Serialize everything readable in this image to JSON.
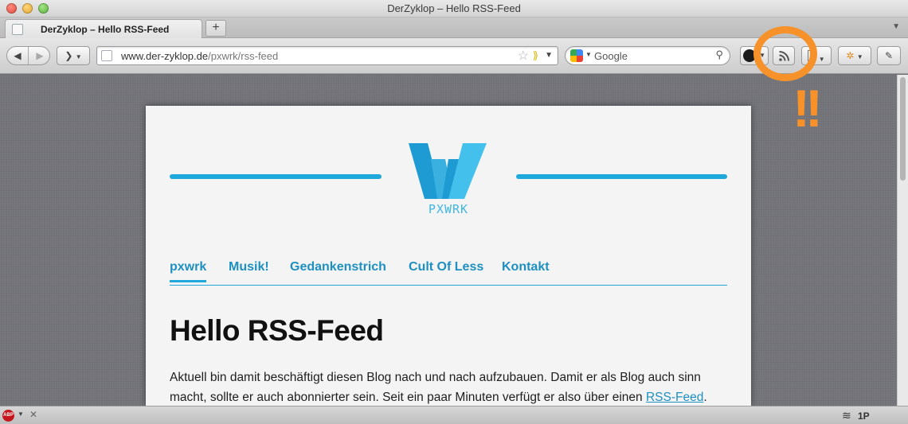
{
  "window": {
    "title": "DerZyklop – Hello RSS-Feed"
  },
  "tabs": [
    {
      "label": "DerZyklop – Hello RSS-Feed"
    }
  ],
  "toolbar": {
    "back_glyph": "◀",
    "forward_glyph": "▶",
    "reader_glyph": "❯",
    "url_domain": "www.der-zyklop.de",
    "url_path": "/pxwrk/rss-feed",
    "search_placeholder": "Google"
  },
  "annotation": {
    "marks": "!!",
    "color": "#f7922a"
  },
  "site": {
    "logo_text": "PXWRK",
    "nav": [
      {
        "label": "pxwrk",
        "active": true
      },
      {
        "label": "Musik!"
      },
      {
        "label": "Gedankenstrich"
      },
      {
        "label": "Cult Of Less"
      },
      {
        "label": "Kontakt"
      }
    ],
    "post": {
      "title": "Hello RSS-Feed",
      "body_line1": "Aktuell bin damit beschäftigt diesen Blog nach und nach aufzubauen. Damit er als Blog auch sinn",
      "body_line2": "macht, sollte er auch abonnierter sein. Seit ein paar Minuten verfügt er also über einen ",
      "body_link": "RSS-Feed",
      "body_end": "."
    }
  },
  "statusbar": {
    "adblock_label": "ABP",
    "close_glyph": "✕",
    "right_label": "1P"
  },
  "colors": {
    "accent": "#1ea8dc",
    "link": "#1e8fc1",
    "annotation": "#f7922a"
  }
}
